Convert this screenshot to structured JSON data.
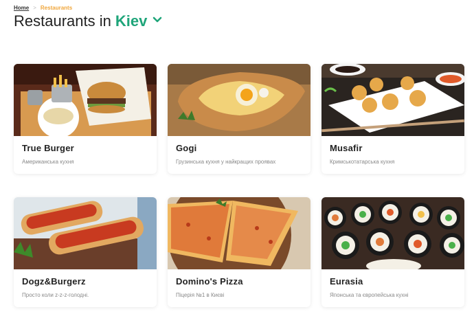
{
  "breadcrumb": {
    "home": "Home",
    "current": "Restaurants"
  },
  "header": {
    "title_prefix": "Restaurants in",
    "city": "Kiev"
  },
  "restaurants": [
    {
      "name": "True Burger",
      "description": "Американська кухня"
    },
    {
      "name": "Gogi",
      "description": "Грузинська кухня у найкращих проявах"
    },
    {
      "name": "Musafir",
      "description": "Кримськотатарська кухня"
    },
    {
      "name": "Dogz&Burgerz",
      "description": "Просто коли z-z-z-голодні."
    },
    {
      "name": "Domino's Pizza",
      "description": "Піцерія №1 в Києві"
    },
    {
      "name": "Eurasia",
      "description": "Японська та європейська кухні"
    }
  ],
  "colors": {
    "accent": "#1fa57a",
    "breadcrumb_current": "#f0a63b"
  }
}
